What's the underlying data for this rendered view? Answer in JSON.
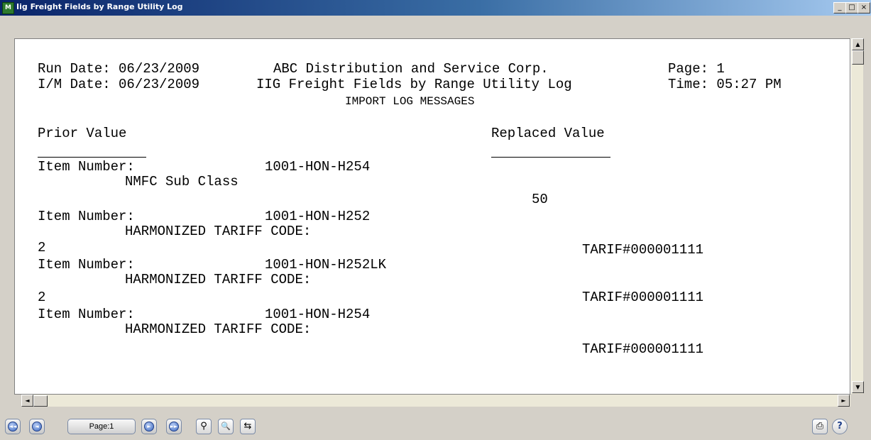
{
  "window": {
    "title": "Iig Freight Fields by Range Utility Log",
    "icon_name": "app-icon",
    "icon_glyph": "M",
    "controls": {
      "minimize": "_",
      "maximize": "□",
      "close": "×"
    }
  },
  "report": {
    "header": {
      "run_date": "Run Date: 06/23/2009",
      "im_date": "I/M Date: 06/23/2009",
      "company": "ABC Distribution and Service Corp.",
      "utility": "IIG Freight Fields by Range Utility Log",
      "subtitle": "IMPORT LOG MESSAGES",
      "page": "Page: 1",
      "time": "Time: 05:27 PM"
    },
    "columns": {
      "prior": "Prior Value",
      "replaced": "Replaced Value"
    },
    "entries": [
      {
        "item_label": "Item Number:",
        "item": "1001-HON-H254",
        "field": "NMFC Sub Class",
        "prior": "",
        "replaced": "50"
      },
      {
        "item_label": "Item Number:",
        "item": "1001-HON-H252",
        "field": "HARMONIZED TARIFF CODE:",
        "prior": "2",
        "replaced": "TARIF#000001111"
      },
      {
        "item_label": "Item Number:",
        "item": "1001-HON-H252LK",
        "field": "HARMONIZED TARIFF CODE:",
        "prior": "2",
        "replaced": "TARIF#000001111"
      },
      {
        "item_label": "Item Number:",
        "item": "1001-HON-H254",
        "field": "HARMONIZED TARIFF CODE:",
        "prior": "",
        "replaced": "TARIF#000001111"
      }
    ]
  },
  "scrollbars": {
    "up": "▲",
    "down": "▼",
    "left": "◄",
    "right": "►"
  },
  "toolbar": {
    "first": "◄◄",
    "prev": "◄",
    "page_label": "Page:1",
    "next": "►",
    "last": "►►",
    "find_icon": "binoculars-icon",
    "find_glyph": "⚲",
    "zoom_icon": "magnifier-icon",
    "zoom_glyph": "🔍",
    "export_icon": "export-icon",
    "export_glyph": "⇆",
    "print_icon": "printer-icon",
    "print_glyph": "⎙",
    "help_icon": "help-icon",
    "help_glyph": "?"
  }
}
